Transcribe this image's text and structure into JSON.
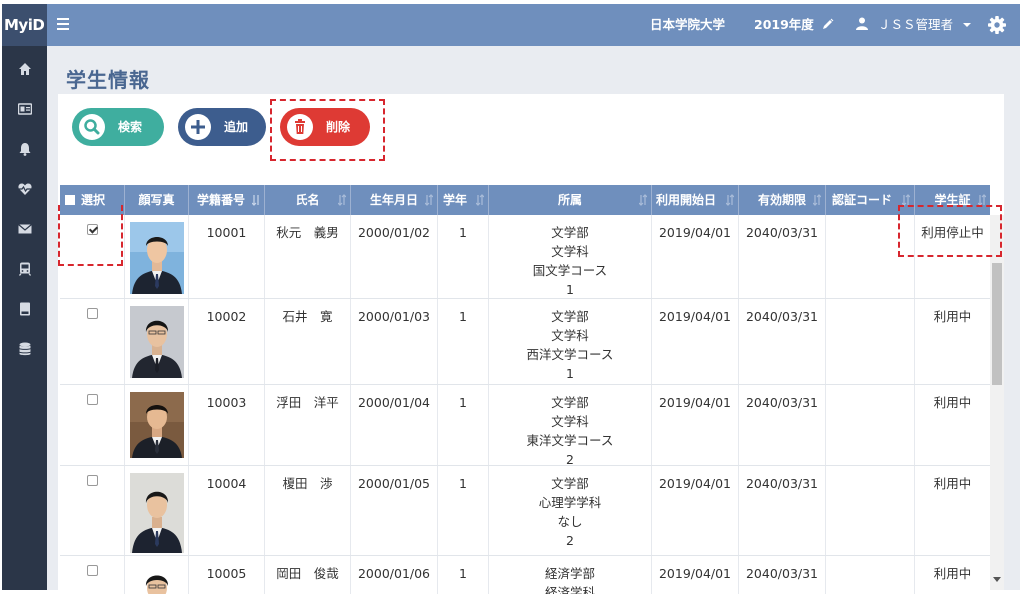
{
  "app": {
    "brand": "MyiD"
  },
  "header": {
    "university": "日本学院大学",
    "year": "2019年度",
    "user": "ＪＳＳ管理者"
  },
  "sidebar": {
    "icons": [
      "home-icon",
      "id-card-icon",
      "bell-icon",
      "heartbeat-icon",
      "envelope-icon",
      "train-icon",
      "book-icon",
      "database-icon"
    ]
  },
  "page": {
    "title": "学生情報"
  },
  "toolbar": {
    "search": "検索",
    "add": "追加",
    "delete": "削除"
  },
  "table": {
    "headers": [
      "選択",
      "顔写真",
      "学籍番号",
      "氏名",
      "生年月日",
      "学年",
      "所属",
      "利用開始日",
      "有効期限",
      "認証コード",
      "学生証"
    ],
    "rows": [
      {
        "checked": true,
        "id": "10001",
        "name": "秋元　義男",
        "birth": "2000/01/02",
        "grade": "1",
        "dept": [
          "文学部",
          "文学科",
          "国文学コース",
          "1"
        ],
        "start": "2019/04/01",
        "expiry": "2040/03/31",
        "code": "",
        "status": "利用停止中"
      },
      {
        "checked": false,
        "id": "10002",
        "name": "石井　寛",
        "birth": "2000/01/03",
        "grade": "1",
        "dept": [
          "文学部",
          "文学科",
          "西洋文学コース",
          "1"
        ],
        "start": "2019/04/01",
        "expiry": "2040/03/31",
        "code": "",
        "status": "利用中"
      },
      {
        "checked": false,
        "id": "10003",
        "name": "浮田　洋平",
        "birth": "2000/01/04",
        "grade": "1",
        "dept": [
          "文学部",
          "文学科",
          "東洋文学コース",
          "2"
        ],
        "start": "2019/04/01",
        "expiry": "2040/03/31",
        "code": "",
        "status": "利用中"
      },
      {
        "checked": false,
        "id": "10004",
        "name": "榎田　渉",
        "birth": "2000/01/05",
        "grade": "1",
        "dept": [
          "文学部",
          "心理学学科",
          "なし",
          "2"
        ],
        "start": "2019/04/01",
        "expiry": "2040/03/31",
        "code": "",
        "status": "利用中"
      },
      {
        "checked": false,
        "id": "10005",
        "name": "岡田　俊哉",
        "birth": "2000/01/06",
        "grade": "1",
        "dept": [
          "経済学部",
          "経済学科"
        ],
        "start": "2019/04/01",
        "expiry": "2040/03/31",
        "code": "",
        "status": "利用中"
      }
    ]
  },
  "colors": {
    "header": "#6f8fbd",
    "sidebar": "#2b3648",
    "search": "#3fae9f",
    "add": "#3d5d8e",
    "delete": "#de3a34",
    "highlight": "#d7262e"
  }
}
